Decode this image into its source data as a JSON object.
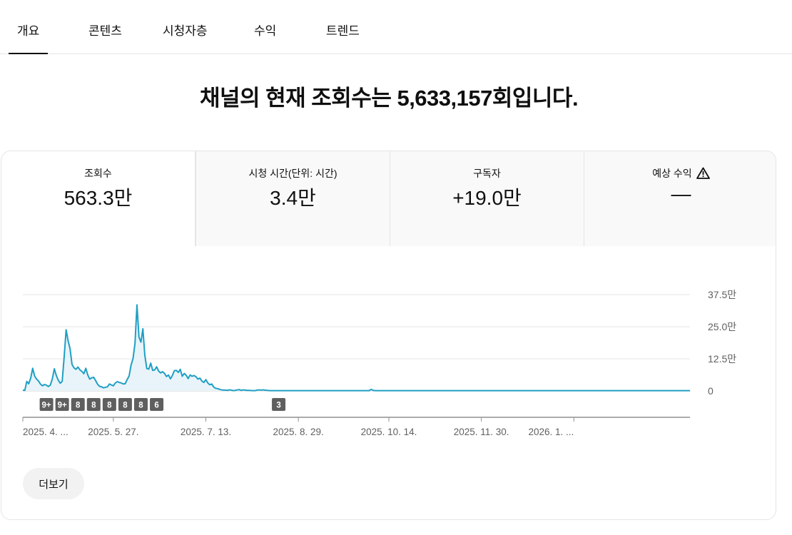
{
  "tabs": [
    {
      "label": "개요",
      "active": true
    },
    {
      "label": "콘텐츠",
      "active": false
    },
    {
      "label": "시청자층",
      "active": false
    },
    {
      "label": "수익",
      "active": false
    },
    {
      "label": "트렌드",
      "active": false
    }
  ],
  "headline": "채널의 현재 조회수는 5,633,157회입니다.",
  "metrics": [
    {
      "label": "조회수",
      "value": "563.3만",
      "selected": true
    },
    {
      "label": "시청 시간(단위: 시간)",
      "value": "3.4만",
      "selected": false
    },
    {
      "label": "구독자",
      "value": "+19.0만",
      "selected": false
    },
    {
      "label": "예상 수익",
      "value": "—",
      "selected": false,
      "icon": "warning-icon"
    }
  ],
  "more_button": "더보기",
  "chart_data": {
    "type": "area",
    "series": [
      {
        "color": "#1f9fc4",
        "fill": "#e8f4f9",
        "values": [
          3000,
          2000,
          37000,
          28000,
          50000,
          88000,
          58000,
          46000,
          38000,
          26000,
          20000,
          25000,
          22000,
          17000,
          23000,
          47000,
          86000,
          60000,
          42000,
          30000,
          37000,
          132000,
          238000,
          195000,
          164000,
          103000,
          90000,
          84000,
          93000,
          82000,
          76000,
          67000,
          88000,
          62000,
          46000,
          51000,
          53000,
          40000,
          26000,
          18000,
          16000,
          12000,
          14000,
          16000,
          27000,
          23000,
          20000,
          31000,
          36000,
          33000,
          31000,
          27000,
          28000,
          44000,
          58000,
          101000,
          126000,
          185000,
          335000,
          210000,
          190000,
          242000,
          138000,
          87000,
          85000,
          108000,
          80000,
          82000,
          94000,
          77000,
          70000,
          75000,
          68000,
          56000,
          62000,
          47000,
          60000,
          79000,
          80000,
          72000,
          84000,
          57000,
          68000,
          61000,
          48000,
          62000,
          57000,
          60000,
          55000,
          46000,
          50000,
          38000,
          33000,
          44000,
          31000,
          24000,
          27000,
          15000,
          10000,
          9000,
          6000,
          4000,
          3000,
          3000,
          2000,
          4000,
          3000,
          1000,
          2000,
          4000,
          5000,
          2000,
          4000,
          3000,
          2000,
          2000,
          1500,
          1000,
          1000,
          3000,
          4000,
          3000,
          4000,
          3000,
          2000,
          1500,
          1000,
          1000,
          1000,
          1000,
          1000,
          1000,
          1000,
          1000,
          1000,
          1000,
          1000,
          1000,
          1000,
          1000,
          1000,
          1000,
          1000,
          1000,
          1000,
          1000,
          1000,
          1000,
          1000,
          1000,
          1000,
          1000,
          1000,
          1000,
          1000,
          1000,
          1000,
          1000,
          1000,
          1000,
          1000,
          1000,
          1000,
          1000,
          1000,
          1000,
          1000,
          1000,
          1000,
          1000,
          1000,
          1000,
          1000,
          1000,
          1000,
          1000,
          1000,
          6000,
          2000,
          1000,
          1000,
          1000,
          1000,
          1000,
          1000,
          1000,
          1000,
          1000,
          1000,
          1000,
          1000,
          1000,
          1000,
          1000,
          1000,
          1000,
          1000,
          1000,
          1000,
          1000,
          1000,
          1000,
          1000,
          1000,
          1000,
          1000,
          1000,
          1000,
          1000,
          1000,
          1000,
          1000,
          1000,
          1000,
          1000,
          1000,
          1000,
          1000,
          1000,
          1000,
          1000,
          1000,
          1000,
          1000,
          1000,
          1000,
          1000,
          1000,
          1000,
          1000,
          1000,
          1000,
          1000,
          1000,
          1000,
          1000,
          1000,
          1000,
          1000,
          1000,
          1000,
          1000,
          1000,
          1000,
          1000,
          1000,
          1000,
          1000,
          1000,
          1000,
          1000,
          1000,
          1000,
          1000,
          1000,
          1000,
          1000,
          1000,
          1000,
          1000,
          1000,
          1000,
          1000,
          1000,
          1000,
          1000,
          1000,
          1000,
          1000,
          1000,
          1000,
          1000,
          1000,
          1000,
          1000,
          1000,
          1000,
          1000,
          1000,
          1000,
          1000,
          1000,
          1000,
          1000,
          1000,
          1000,
          1000,
          1000,
          1000,
          1000,
          1000,
          1000,
          1000,
          1000,
          1000,
          1000,
          1000,
          1000,
          1000,
          1000,
          1000,
          1000,
          1000,
          1000,
          1000,
          1000,
          1000,
          1000,
          1000,
          1000,
          1000,
          1000,
          1000,
          1000,
          1000,
          1000,
          1000,
          1000,
          1000,
          1000,
          1000,
          1000,
          1000,
          1000,
          1000,
          1000,
          1000,
          1000,
          1000,
          1000,
          1000,
          1000,
          1000,
          1000,
          1000,
          1000,
          1000,
          1000,
          1000,
          1000
        ]
      }
    ],
    "y_ticks": [
      {
        "value": 375000,
        "label": "37.5만"
      },
      {
        "value": 250000,
        "label": "25.0만"
      },
      {
        "value": 125000,
        "label": "12.5만"
      },
      {
        "value": 0,
        "label": "0"
      }
    ],
    "ylim": [
      0,
      375000
    ],
    "x_ticks": [
      {
        "index": 0,
        "label": "2025. 4. ...",
        "anchor": "start"
      },
      {
        "index": 46,
        "label": "2025. 5. 27.",
        "anchor": "middle"
      },
      {
        "index": 93,
        "label": "2025. 7. 13.",
        "anchor": "middle"
      },
      {
        "index": 140,
        "label": "2025. 8. 29.",
        "anchor": "middle"
      },
      {
        "index": 186,
        "label": "2025. 10. 14.",
        "anchor": "middle"
      },
      {
        "index": 233,
        "label": "2025. 11. 30.",
        "anchor": "middle"
      },
      {
        "index": 280,
        "label": "2026. 1. ...",
        "anchor": "end"
      }
    ],
    "markers": [
      {
        "index": 12,
        "label": "9+"
      },
      {
        "index": 20,
        "label": "9+"
      },
      {
        "index": 28,
        "label": "8"
      },
      {
        "index": 36,
        "label": "8"
      },
      {
        "index": 44,
        "label": "8"
      },
      {
        "index": 52,
        "label": "8"
      },
      {
        "index": 60,
        "label": "8"
      },
      {
        "index": 68,
        "label": "6"
      },
      {
        "index": 130,
        "label": "3"
      }
    ]
  }
}
